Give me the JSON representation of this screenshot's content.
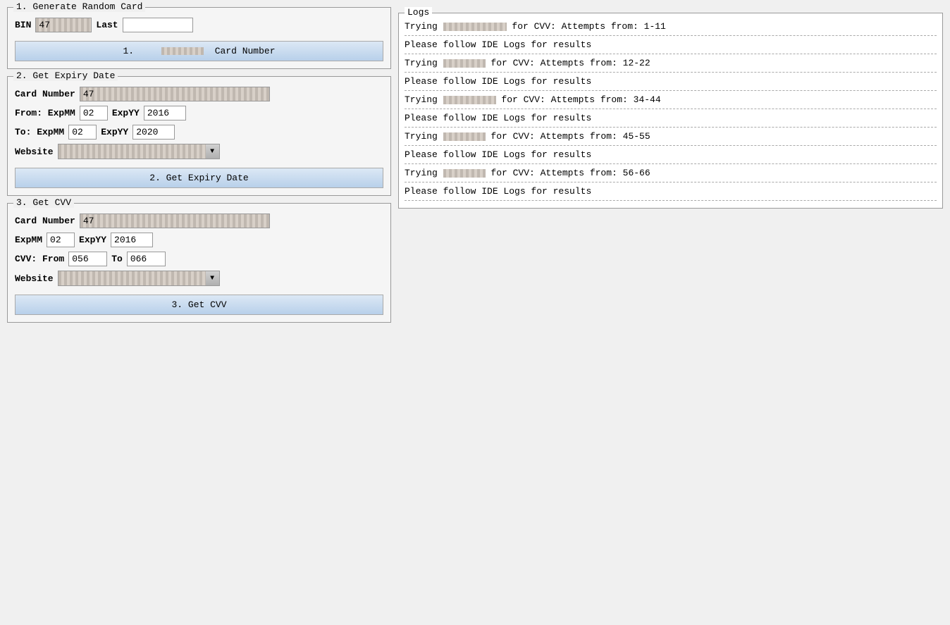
{
  "section1": {
    "title": "1. Generate Random Card",
    "bin_label": "BIN",
    "bin_value": "47",
    "last_label": "Last",
    "last_value": "",
    "button_label": "1.      Card Number"
  },
  "section2": {
    "title": "2. Get Expiry Date",
    "card_number_label": "Card Number",
    "card_number_value": "47",
    "from_label": "From: ExpMM",
    "from_mm_value": "02",
    "from_yy_label": "ExpYY",
    "from_yy_value": "2016",
    "to_label": "To: ExpMM",
    "to_mm_value": "02",
    "to_yy_label": "ExpYY",
    "to_yy_value": "2020",
    "website_label": "Website",
    "website_value": "",
    "button_label": "2. Get Expiry Date"
  },
  "section3": {
    "title": "3. Get CVV",
    "card_number_label": "Card Number",
    "card_number_value": "47",
    "expmm_label": "ExpMM",
    "expmm_value": "02",
    "expyy_label": "ExpYY",
    "expyy_value": "2016",
    "cvv_from_label": "CVV: From",
    "cvv_from_value": "056",
    "cvv_to_label": "To",
    "cvv_to_value": "066",
    "website_label": "Website",
    "website_value": "",
    "button_label": "3. Get CVV"
  },
  "logs": {
    "title": "Logs",
    "entries": [
      {
        "type": "trying",
        "text": "Trying",
        "masked_size": "lg",
        "suffix": " for CVV: Attempts from: 1-11"
      },
      {
        "type": "divider"
      },
      {
        "type": "info",
        "text": "Please follow IDE Logs for results"
      },
      {
        "type": "divider"
      },
      {
        "type": "trying",
        "text": "Trying",
        "masked_size": "sm",
        "suffix": " for CVV: Attempts from: 12-22"
      },
      {
        "type": "divider"
      },
      {
        "type": "info",
        "text": "Please follow IDE Logs for results"
      },
      {
        "type": "divider"
      },
      {
        "type": "trying",
        "text": "Trying",
        "masked_size": "md",
        "suffix": " for CVV: Attempts from: 34-44"
      },
      {
        "type": "divider"
      },
      {
        "type": "info",
        "text": "Please follow IDE Logs for results"
      },
      {
        "type": "divider"
      },
      {
        "type": "trying",
        "text": "Trying",
        "masked_size": "sm",
        "suffix": " for CVV: Attempts from: 45-55"
      },
      {
        "type": "divider"
      },
      {
        "type": "info",
        "text": "Please follow IDE Logs for results"
      },
      {
        "type": "divider"
      },
      {
        "type": "trying",
        "text": "Trying",
        "masked_size": "sm",
        "suffix": " for CVV: Attempts from: 56-66"
      },
      {
        "type": "divider"
      },
      {
        "type": "info",
        "text": "Please follow IDE Logs for results"
      },
      {
        "type": "divider"
      }
    ]
  }
}
